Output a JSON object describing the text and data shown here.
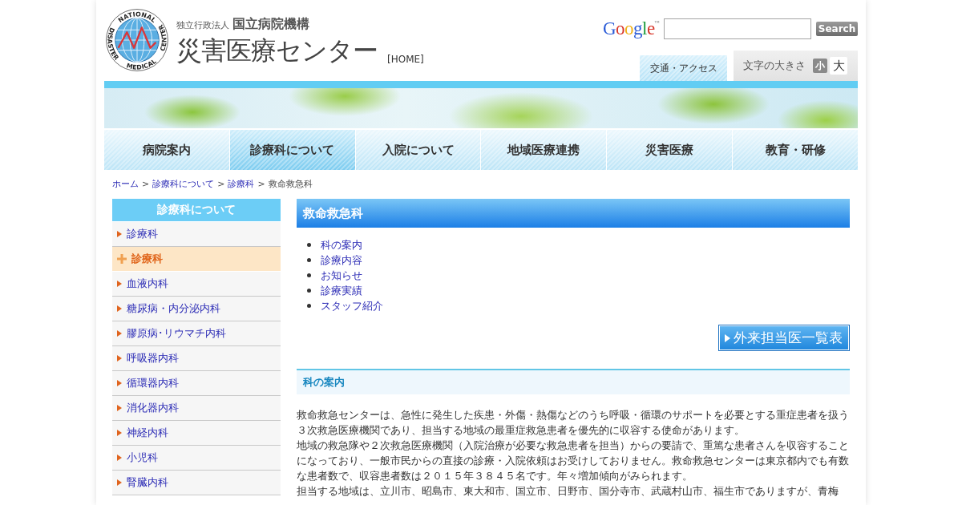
{
  "header": {
    "logo": {
      "ring_texts": [
        "NATIONAL",
        "DISASTER",
        "MEDICAL",
        "CENTER"
      ]
    },
    "org_prefix": "独立行政法人",
    "org_name": "国立病院機構",
    "site_title": "災害医療センター",
    "home_link": "[HOME]"
  },
  "search": {
    "logo": "Google",
    "logo_mark": "™",
    "button": "Search"
  },
  "access_link": "交通・アクセス",
  "text_size": {
    "label": "文字の大きさ",
    "options": [
      {
        "label": "小",
        "selected": true
      },
      {
        "label": "大",
        "selected": false
      }
    ]
  },
  "nav": [
    {
      "label": "病院案内",
      "selected": false
    },
    {
      "label": "診療科について",
      "selected": true
    },
    {
      "label": "入院について",
      "selected": false
    },
    {
      "label": "地域医療連携",
      "selected": false
    },
    {
      "label": "災害医療",
      "selected": false
    },
    {
      "label": "教育・研修",
      "selected": false
    }
  ],
  "breadcrumb": [
    {
      "kind": "link",
      "label": "ホーム"
    },
    {
      "kind": "separator",
      "label": ">"
    },
    {
      "kind": "link",
      "label": "診療科について"
    },
    {
      "kind": "separator",
      "label": ">"
    },
    {
      "kind": "link",
      "label": "診療科"
    },
    {
      "kind": "separator",
      "label": ">"
    },
    {
      "kind": "current",
      "label": "救命救急科"
    }
  ],
  "sidebar": {
    "title": "診療科について",
    "items": [
      {
        "label": "診療科",
        "selected": false
      },
      {
        "label": "診療科",
        "selected": true
      },
      {
        "label": "血液内科",
        "selected": false
      },
      {
        "label": "糖尿病・内分泌内科",
        "selected": false
      },
      {
        "label": "膠原病･リウマチ内科",
        "selected": false
      },
      {
        "label": "呼吸器内科",
        "selected": false
      },
      {
        "label": "循環器内科",
        "selected": false
      },
      {
        "label": "消化器内科",
        "selected": false
      },
      {
        "label": "神経内科",
        "selected": false
      },
      {
        "label": "小児科",
        "selected": false
      },
      {
        "label": "腎臓内科",
        "selected": false
      }
    ]
  },
  "main": {
    "title": "救命救急科",
    "links": [
      "科の案内",
      "診療内容",
      "お知らせ",
      "診療実績",
      "スタッフ紹介"
    ],
    "button": "外来担当医一覧表",
    "section_title": "科の案内",
    "paragraphs": [
      "救命救急センターは、急性に発生した疾患・外傷・熱傷などのうち呼吸・循環のサポートを必要とする重症患者を扱う３次救急医療機関であり、担当する地域の最重症救急患者を優先的に収容する使命があります。",
      "地域の救急隊や２次救急医療機関（入院治療が必要な救急患者を担当）からの要請で、重篤な患者さんを収容することになっており、一般市民からの直接の診療・入院依頼はお受けしておりません。救命救急センターは東京都内でも有数な患者数で、収容患者数は２０１５年３８４５名です。年々増加傾向がみられます。",
      "担当する地域は、立川市、昭島市、東大和市、国立市、日野市、国分寺市、武蔵村山市、福生市でありますが、青梅"
    ]
  }
}
